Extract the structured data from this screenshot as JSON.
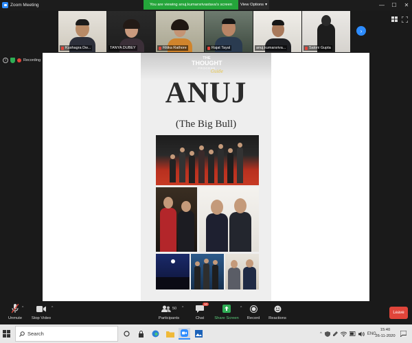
{
  "window": {
    "title": "Zoom Meeting",
    "controls": {
      "minimize": "—",
      "maximize": "☐",
      "close": "✕"
    }
  },
  "banner": {
    "viewing_text": "You are viewing anuj.kumarsrivastava's screen",
    "view_options_label": "View Options",
    "view_options_caret": "▾"
  },
  "participants": [
    {
      "name": "Kushagra Dw...",
      "muted": true
    },
    {
      "name": "TANYA DUBEY",
      "muted": false
    },
    {
      "name": "Ritika Rathore",
      "muted": true
    },
    {
      "name": "Rajat Tayal",
      "muted": true
    },
    {
      "name": "anuj.kumarsriva...",
      "muted": false
    },
    {
      "name": "Saloni Gupta",
      "muted": true
    }
  ],
  "strip_next_icon": "›",
  "recording": {
    "label": "Recording",
    "info_icon": "i"
  },
  "shared_document": {
    "logo": {
      "line1": "THE",
      "line2": "THOUGHT",
      "line3": "PROCESS",
      "line4": "Guide"
    },
    "heading": "ANUJ",
    "subheading": "(The Big Bull)"
  },
  "toolbar": {
    "unmute": "Unmute",
    "stop_video": "Stop Video",
    "participants": "Participants",
    "participants_count": "50",
    "chat": "Chat",
    "chat_badge": "10",
    "share_screen": "Share Screen",
    "record": "Record",
    "reactions": "Reactions",
    "leave": "Leave",
    "caret": "^"
  },
  "taskbar": {
    "search_placeholder": "Search",
    "language": "ENG",
    "time": "15:40",
    "date": "26-11-2020",
    "hidden_icons": "^"
  },
  "colors": {
    "zoom_blue": "#2d8cff",
    "banner_green": "#24a53a",
    "leave_red": "#e0453a",
    "share_green": "#2fae55"
  }
}
